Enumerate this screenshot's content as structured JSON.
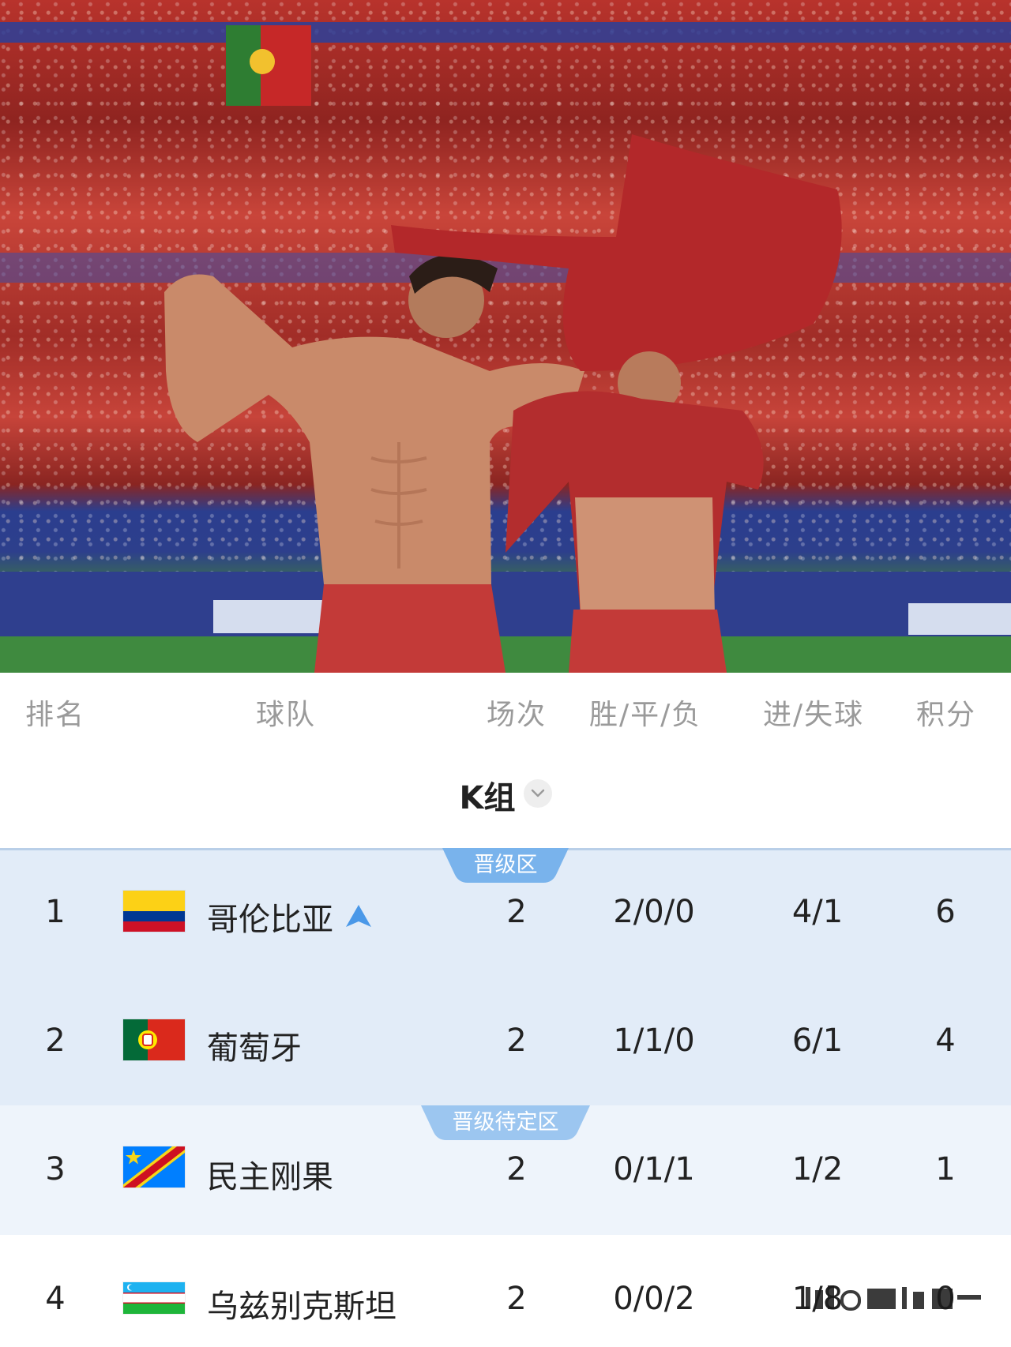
{
  "header": {
    "rank": "排名",
    "team": "球队",
    "played": "场次",
    "wdl": "胜/平/负",
    "goals": "进/失球",
    "points": "积分"
  },
  "group": {
    "title": "K组",
    "selector_icon": "chevron-down-icon"
  },
  "zones": {
    "qualify_label": "晋级区",
    "pending_label": "晋级待定区",
    "qualify_color": "#e2ecf8",
    "pending_color": "#eef4fb",
    "tab_color": "#79b3ec"
  },
  "teams": [
    {
      "rank": "1",
      "name": "哥伦比亚",
      "flag": "colombia-flag",
      "trend": "up-arrow-icon",
      "played": "2",
      "wdl": "2/0/0",
      "goals": "4/1",
      "points": "6"
    },
    {
      "rank": "2",
      "name": "葡萄牙",
      "flag": "portugal-flag",
      "played": "2",
      "wdl": "1/1/0",
      "goals": "6/1",
      "points": "4"
    },
    {
      "rank": "3",
      "name": "民主刚果",
      "flag": "dr-congo-flag",
      "played": "2",
      "wdl": "0/1/1",
      "goals": "1/2",
      "points": "1"
    },
    {
      "rank": "4",
      "name": "乌兹别克斯坦",
      "flag": "uzbekistan-flag",
      "played": "2",
      "wdl": "0/0/2",
      "goals": "1/8",
      "points": "0"
    }
  ]
}
